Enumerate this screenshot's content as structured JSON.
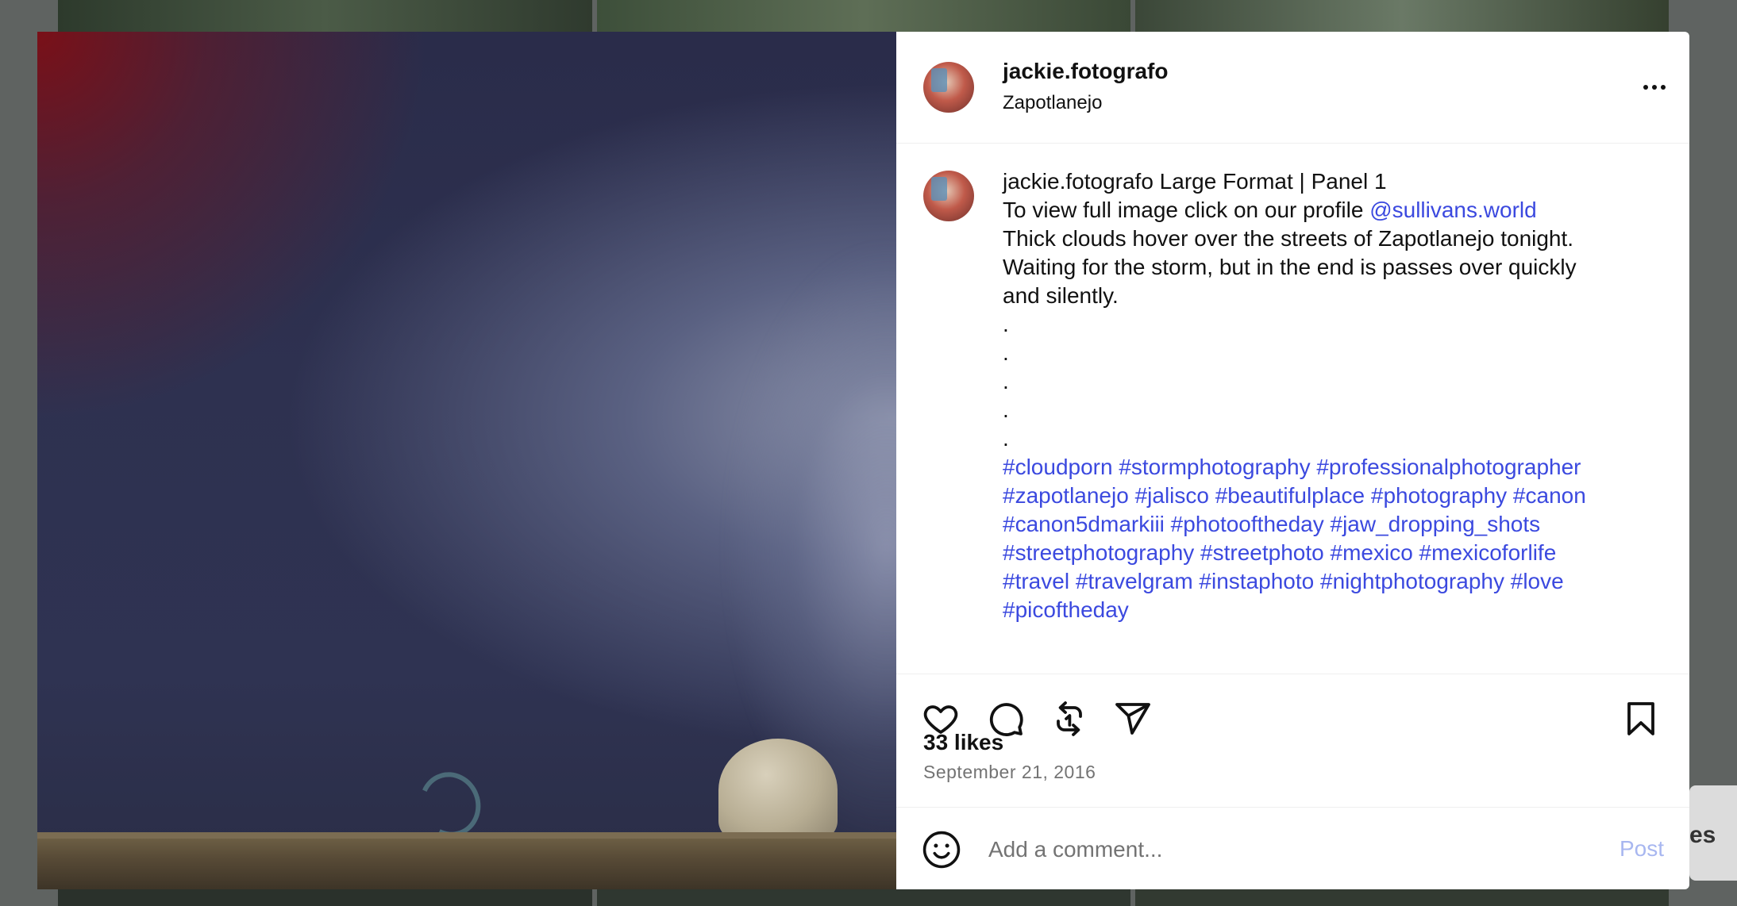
{
  "post": {
    "username": "jackie.fotografo",
    "location": "Zapotlanejo",
    "caption": {
      "title": "Large Format | Panel 1",
      "line2_prefix": "To view full image click on our profile",
      "mention": "@sullivans.world",
      "line3": "Thick clouds hover over the streets of Zapotlanejo tonight.",
      "line4": "Waiting for the storm, but in the end is passes over quickly",
      "line5": "and silently.",
      "dots": [
        ".",
        ".",
        ".",
        ".",
        "."
      ],
      "hashtag_lines": [
        "#cloudporn #stormphotography #professionalphotographer",
        "#zapotlanejo #jalisco #beautifulplace #photography #canon",
        "#canon5dmarkiii #photooftheday #jaw_dropping_shots",
        "#streetphotography #streetphoto #mexico #mexicoforlife",
        "#travel #travelgram #instaphoto #nightphotography #love",
        "#picoftheday"
      ]
    },
    "likes": "33 likes",
    "date": "September 21, 2016"
  },
  "actions": {
    "like_icon": "heart-icon",
    "comment_icon": "comment-bubble-icon",
    "repost_icon": "repost-icon",
    "share_icon": "send-icon",
    "save_icon": "bookmark-icon"
  },
  "comment_bar": {
    "placeholder": "Add a comment...",
    "post_label": "Post",
    "emoji_icon": "smiley-icon"
  },
  "background": {
    "side_text": "es"
  },
  "colors": {
    "link": "#3b49df",
    "post_disabled": "#a8b7f0",
    "muted": "#737373"
  }
}
